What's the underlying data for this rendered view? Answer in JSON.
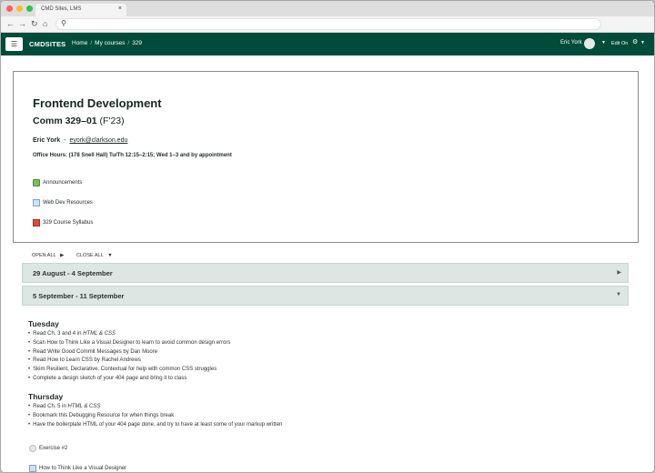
{
  "browser": {
    "tab_title": "CMD Sites, LMS",
    "tab_close": "×"
  },
  "header": {
    "menu_icon": "☰",
    "brand": "CMDSITES",
    "breadcrumbs": [
      "Home",
      "My courses",
      "329"
    ],
    "breadcrumb_sep": "/",
    "user_name": "Eric York",
    "edit_on": "Edit On"
  },
  "course": {
    "title": "Frontend Development",
    "code": "Comm 329–01",
    "term": "(F'23)",
    "instructor": "Eric York",
    "dash": "-",
    "email": "eyork@clarkson.edu",
    "office_hours": "Office Hours: (178 Snell Hall) Tu/Th 12:15–2:15; Wed 1–3 and by appointment",
    "resources": [
      {
        "label": "Announcements",
        "icon": "announcements-icon"
      },
      {
        "label": "Web Dev Resources",
        "icon": "file-icon"
      },
      {
        "label": "329 Course Syllabus",
        "icon": "pdf-icon"
      }
    ]
  },
  "controls": {
    "open_all": "OPEN ALL",
    "close_all": "CLOSE ALL"
  },
  "sections": [
    {
      "title": "29 August - 4 September",
      "state": "collapsed"
    },
    {
      "title": "5 September - 11 September",
      "state": "expanded"
    }
  ],
  "tuesday": {
    "heading": "Tuesday",
    "items": [
      {
        "pre": "Read Ch. 3 and 4 in ",
        "em": "HTML & CSS",
        "post": ""
      },
      {
        "pre": "Scan ",
        "em": "How to Think Like a Visual Designer",
        "post": " to learn to avoid common design errors"
      },
      {
        "pre": "Read ",
        "em": "Write Good Commit Messages",
        "post": " by Dan Moore"
      },
      {
        "pre": "Read ",
        "em": "How to Learn CSS",
        "post": " by Rachel Andrews"
      },
      {
        "pre": "Skim ",
        "em": "Resilient, Declarative, Contextual",
        "post": " for help with common CSS struggles"
      },
      {
        "pre": "Complete a design sketch of your 404 page and bring it to class",
        "em": "",
        "post": ""
      }
    ]
  },
  "thursday": {
    "heading": "Thursday",
    "items": [
      {
        "pre": "Read Ch. 5 in ",
        "em": "HTML & CSS",
        "post": ""
      },
      {
        "pre": "Bookmark this ",
        "em": "Debugging Resource",
        "post": " for when things break"
      },
      {
        "pre": "Have the boilerplate HTML of your 404 page done, and try to have at least some of your markup written",
        "em": "",
        "post": ""
      }
    ]
  },
  "activities": [
    {
      "label": "Exercise #2",
      "icon": "exercise-icon"
    },
    {
      "label": "How to Think Like a Visual Designer",
      "icon": "file-icon"
    }
  ],
  "colors": {
    "header_bg": "#004c3a",
    "section_bg": "#dce6e2"
  }
}
